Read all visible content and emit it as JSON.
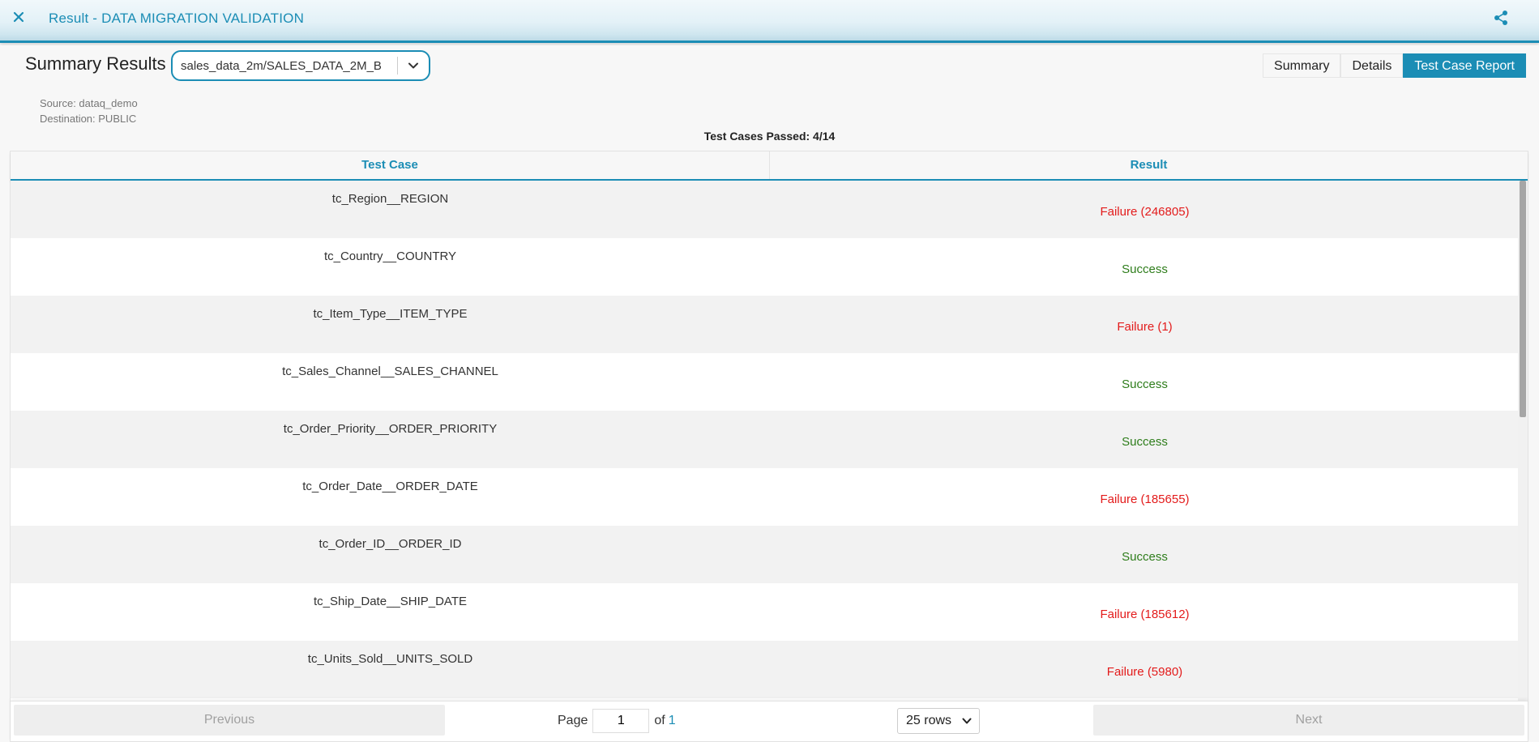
{
  "header": {
    "title": "Result - DATA MIGRATION VALIDATION",
    "close_icon": "close-icon",
    "share_icon": "share-icon"
  },
  "summary": {
    "heading": "Summary Results",
    "dataset_selected": "sales_data_2m/SALES_DATA_2M_B",
    "tabs": [
      {
        "label": "Summary",
        "active": false
      },
      {
        "label": "Details",
        "active": false
      },
      {
        "label": "Test Case Report",
        "active": true
      }
    ],
    "source": "Source: dataq_demo",
    "destination": "Destination: PUBLIC",
    "passed": "Test Cases Passed: 4/14"
  },
  "table": {
    "columns": [
      "Test Case",
      "Result"
    ],
    "rows": [
      {
        "test_case": "tc_Region__REGION",
        "result": "Failure (246805)",
        "status": "failure"
      },
      {
        "test_case": "tc_Country__COUNTRY",
        "result": "Success",
        "status": "success"
      },
      {
        "test_case": "tc_Item_Type__ITEM_TYPE",
        "result": "Failure (1)",
        "status": "failure"
      },
      {
        "test_case": "tc_Sales_Channel__SALES_CHANNEL",
        "result": "Success",
        "status": "success"
      },
      {
        "test_case": "tc_Order_Priority__ORDER_PRIORITY",
        "result": "Success",
        "status": "success"
      },
      {
        "test_case": "tc_Order_Date__ORDER_DATE",
        "result": "Failure (185655)",
        "status": "failure"
      },
      {
        "test_case": "tc_Order_ID__ORDER_ID",
        "result": "Success",
        "status": "success"
      },
      {
        "test_case": "tc_Ship_Date__SHIP_DATE",
        "result": "Failure (185612)",
        "status": "failure"
      },
      {
        "test_case": "tc_Units_Sold__UNITS_SOLD",
        "result": "Failure (5980)",
        "status": "failure"
      }
    ]
  },
  "pager": {
    "previous": "Previous",
    "next": "Next",
    "page_label": "Page",
    "page_value": "1",
    "of_label": "of",
    "total_pages": "1",
    "rows_option": "25 rows"
  },
  "colors": {
    "accent": "#1b8db5",
    "success": "#2e7d1b",
    "failure": "#e31b1b"
  }
}
